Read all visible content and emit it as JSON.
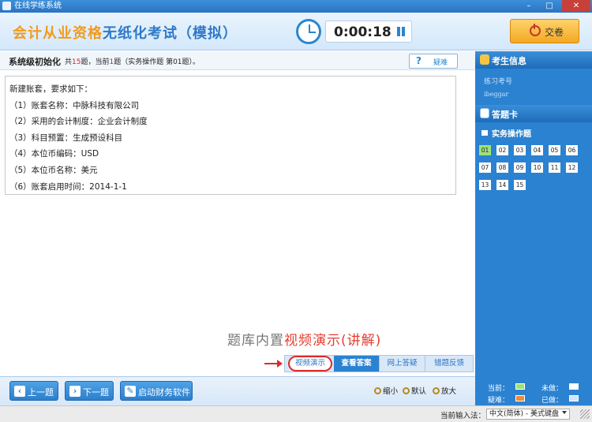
{
  "window": {
    "title": "在线学练系统"
  },
  "header": {
    "title_highlight": "会计从业资格",
    "title_rest": "无纸化考试（模拟）",
    "timer": "0:00:18",
    "submit_label": "交卷"
  },
  "question_bar": {
    "topic": "系统级初始化",
    "prefix": "共",
    "total": "15",
    "mid": "题，当前",
    "current": "1",
    "suffix": "题（实务操作题 第01题）。",
    "doubt_label": "疑难"
  },
  "question": {
    "lines": [
      "新建账套，要求如下：",
      "（1）账套名称：中脉科技有限公司",
      "（2）采用的会计制度：企业会计制度",
      "（3）科目预置：生成预设科目",
      "（4）本位币编码：USD",
      "（5）本位币名称：美元",
      "（6）账套启用时间：2014-1-1"
    ]
  },
  "promo": {
    "prefix": "题库内置",
    "highlight": "视频演示(讲解)"
  },
  "tabs": [
    "视频演示",
    "查看答案",
    "网上答疑",
    "错题反馈"
  ],
  "bottom": {
    "prev_label": "上一题",
    "next_label": "下一题",
    "finance_label": "启动财务软件",
    "zoom_out": "缩小",
    "zoom_default": "默认",
    "zoom_in": "放大"
  },
  "right_panel": {
    "student_header": "考生信息",
    "student_label": "练习考号",
    "student_id": "ibeggar",
    "card_header": "答题卡",
    "category": "实务操作题",
    "numbers": [
      "01",
      "02",
      "03",
      "04",
      "05",
      "06",
      "07",
      "08",
      "09",
      "10",
      "11",
      "12",
      "13",
      "14",
      "15"
    ],
    "current_number": "01",
    "legend": {
      "current": "当前：",
      "undone": "未做：",
      "doubt": "疑难：",
      "done": "已做："
    }
  },
  "statusbar": {
    "label": "当前输入法：",
    "ime": "中文(简体) - 美式键盘"
  },
  "colors": {
    "accent": "#2b82d1",
    "title_orange": "#f39a1b",
    "highlight_red": "#e53e2f",
    "current_green": "#9ee27a",
    "doubt_orange": "#f08a3c"
  }
}
